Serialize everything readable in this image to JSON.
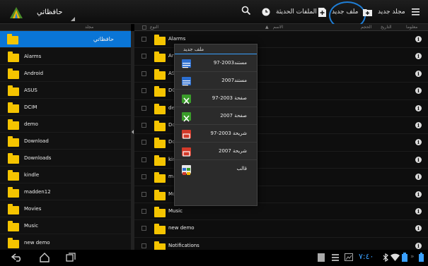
{
  "app": {
    "title": "حافظاتي",
    "accent": "#0a75d6",
    "folder_color": "#f5c400"
  },
  "toolbar": {
    "new_folder_label": "مجلد جديد",
    "new_file_label": "ملف جديد",
    "recent_files_label": "الملفات الحديثة",
    "icons": [
      "menu-icon",
      "new-folder-icon",
      "new-file-icon",
      "recent-files-icon",
      "search-icon"
    ]
  },
  "left_header": {
    "folder_col": "مجلد"
  },
  "right_header": {
    "info_col": "معلوما",
    "date_col": "التاريخ",
    "size_col": "الحجم",
    "name_col": "الاسم",
    "type_col": "النوع"
  },
  "tree": {
    "root_label": "حافظاتي",
    "items": [
      "Alarms",
      "Android",
      "ASUS",
      "DCIM",
      "demo",
      "Download",
      "Downloads",
      "kindle",
      "madden12",
      "Movies",
      "Music",
      "new demo"
    ]
  },
  "files": {
    "items": [
      "Alarms",
      "An",
      "AS",
      "DC",
      "der",
      "Do",
      "Do",
      "kin",
      "ma",
      "Mc",
      "Music",
      "new demo",
      "Notifications"
    ]
  },
  "new_file_menu": {
    "title": "ملف جديد",
    "items": [
      {
        "label": "مستند2003-97",
        "icon": "word-doc-icon"
      },
      {
        "label": "مستند2007",
        "icon": "word-docx-icon"
      },
      {
        "label": "صفحة 2003-97",
        "icon": "excel-xls-icon"
      },
      {
        "label": "صفحة 2007",
        "icon": "excel-xlsx-icon"
      },
      {
        "label": "شريحة 2003-97",
        "icon": "ppt-icon"
      },
      {
        "label": "شريحة 2007",
        "icon": "pptx-icon"
      },
      {
        "label": "قالب",
        "icon": "template-icon"
      }
    ]
  },
  "status_bar": {
    "time": "٧:٤٠",
    "icons": [
      "back-icon",
      "home-icon",
      "recent-apps-icon",
      "notification-icon",
      "usb-icon",
      "screenshot-icon",
      "bluetooth-icon",
      "wifi-icon",
      "battery-icon"
    ]
  }
}
